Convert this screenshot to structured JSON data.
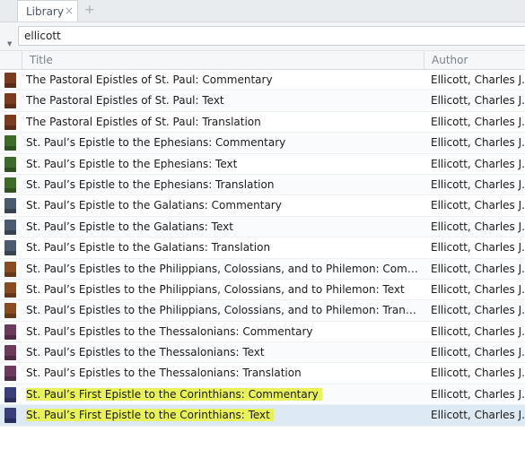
{
  "tab": {
    "label": "Library",
    "close_glyph": "×",
    "add_glyph": "+"
  },
  "search": {
    "value": "ellicott",
    "caret_glyph": "▼"
  },
  "columns": {
    "title": "Title",
    "author": "Author"
  },
  "rows": [
    {
      "title": "The Pastoral Epistles of St. Paul: Commentary",
      "author": "Ellicott, Charles J.",
      "thumb_color": "#7a3b1f"
    },
    {
      "title": "The Pastoral Epistles of St. Paul: Text",
      "author": "Ellicott, Charles J.",
      "thumb_color": "#7a3b1f"
    },
    {
      "title": "The Pastoral Epistles of St. Paul: Translation",
      "author": "Ellicott, Charles J.",
      "thumb_color": "#7a3b1f"
    },
    {
      "title": "St. Paul’s Epistle to the Ephesians: Commentary",
      "author": "Ellicott, Charles J.",
      "thumb_color": "#3f6b2a"
    },
    {
      "title": "St. Paul’s Epistle to the Ephesians: Text",
      "author": "Ellicott, Charles J.",
      "thumb_color": "#3f6b2a"
    },
    {
      "title": "St. Paul’s Epistle to the Ephesians: Translation",
      "author": "Ellicott, Charles J.",
      "thumb_color": "#3f6b2a"
    },
    {
      "title": "St. Paul’s Epistle to the Galatians: Commentary",
      "author": "Ellicott, Charles J.",
      "thumb_color": "#4a5a6f"
    },
    {
      "title": "St. Paul’s Epistle to the Galatians: Text",
      "author": "Ellicott, Charles J.",
      "thumb_color": "#4a5a6f"
    },
    {
      "title": "St. Paul’s Epistle to the Galatians: Translation",
      "author": "Ellicott, Charles J.",
      "thumb_color": "#4a5a6f"
    },
    {
      "title": "St. Paul’s Epistles to the Philippians, Colossians, and to Philemon: Comment…",
      "author": "Ellicott, Charles J.",
      "thumb_color": "#8a4a22"
    },
    {
      "title": "St. Paul’s Epistles to the Philippians, Colossians, and to Philemon: Text",
      "author": "Ellicott, Charles J.",
      "thumb_color": "#8a4a22"
    },
    {
      "title": "St. Paul’s Epistles to the Philippians, Colossians, and to Philemon: Translation",
      "author": "Ellicott, Charles J.",
      "thumb_color": "#8a4a22"
    },
    {
      "title": "St. Paul’s Epistles to the Thessalonians: Commentary",
      "author": "Ellicott, Charles J.",
      "thumb_color": "#6d3a5e"
    },
    {
      "title": "St. Paul’s Epistles to the Thessalonians: Text",
      "author": "Ellicott, Charles J.",
      "thumb_color": "#6d3a5e"
    },
    {
      "title": "St. Paul’s Epistles to the Thessalonians: Translation",
      "author": "Ellicott, Charles J.",
      "thumb_color": "#6d3a5e"
    },
    {
      "title": "St. Paul’s First Epistle to the Corinthians: Commentary",
      "author": "Ellicott, Charles J.",
      "thumb_color": "#3a3f7a"
    },
    {
      "title": "St. Paul’s First Epistle to the Corinthians: Text",
      "author": "Ellicott, Charles J.",
      "thumb_color": "#3a3f7a"
    }
  ],
  "highlight_color": "#e9f25b",
  "selected_color": "#dde9f3"
}
